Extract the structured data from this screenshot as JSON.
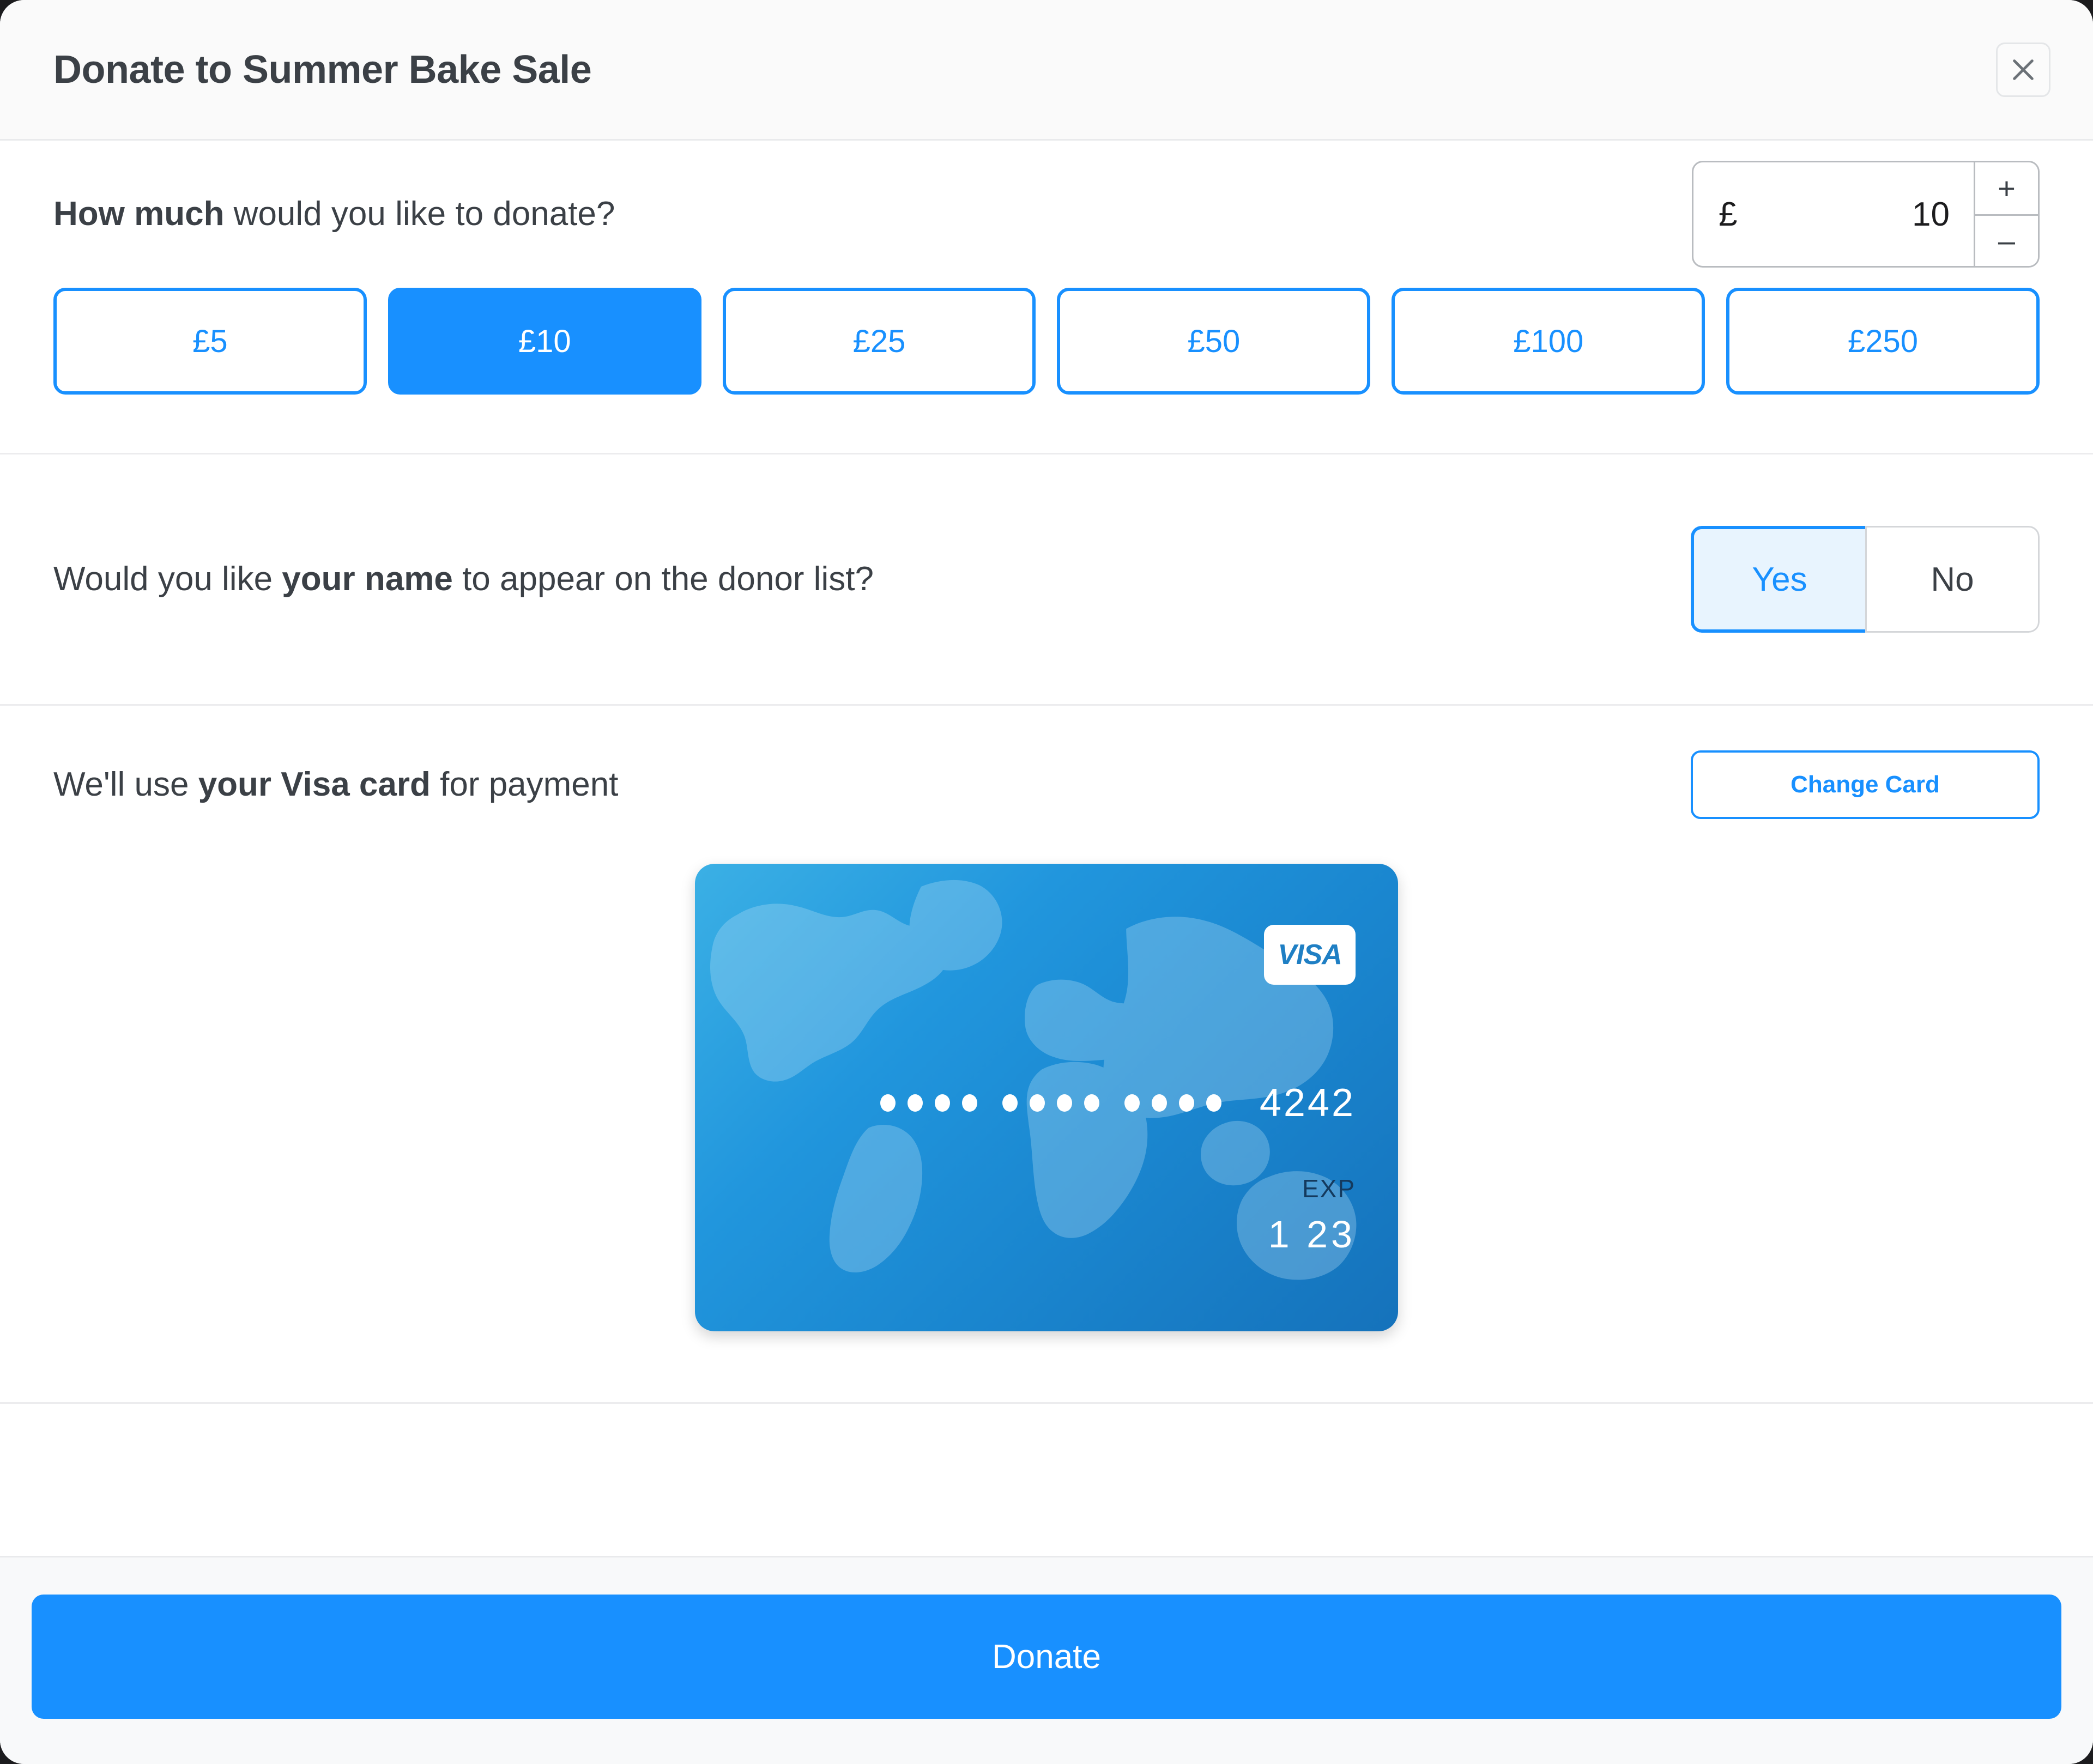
{
  "modal": {
    "title": "Donate to Summer Bake Sale",
    "close_icon": "close-icon",
    "accent_color": "#1890ff",
    "accent_soft_color": "#e8f4fe",
    "text_color": "#3b4046"
  },
  "amount_section": {
    "prompt_bold": "How much",
    "prompt_rest": " would you like to donate?",
    "currency_symbol": "£",
    "value": "10",
    "placeholder": "0",
    "increment_label": "+",
    "decrement_label": "–",
    "presets": [
      {
        "label": "£5",
        "selected": false
      },
      {
        "label": "£10",
        "selected": true
      },
      {
        "label": "£25",
        "selected": false
      },
      {
        "label": "£50",
        "selected": false
      },
      {
        "label": "£100",
        "selected": false
      },
      {
        "label": "£250",
        "selected": false
      }
    ]
  },
  "donor_section": {
    "prompt_start": "Would you like ",
    "prompt_bold": "your name",
    "prompt_end": " to appear on the donor list?",
    "options": [
      {
        "label": "Yes",
        "selected": true
      },
      {
        "label": "No",
        "selected": false
      }
    ]
  },
  "payment_section": {
    "prompt_start": "We'll use ",
    "prompt_bold": "your Visa card",
    "prompt_end": " for payment",
    "change_card_label": "Change Card",
    "card": {
      "brand": "VISA",
      "masked_groups": [
        "••••",
        "••••",
        "••••"
      ],
      "last_four": "4242",
      "exp_label": "EXP",
      "exp_value": "1  23"
    }
  },
  "footer": {
    "donate_label": "Donate"
  }
}
